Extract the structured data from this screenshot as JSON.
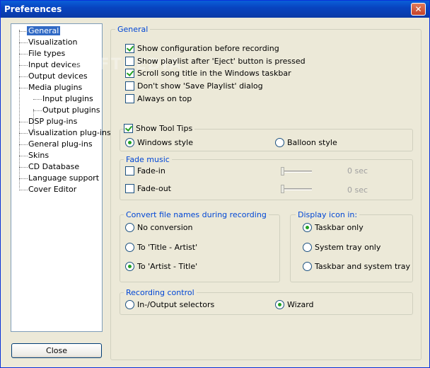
{
  "window": {
    "title": "Preferences",
    "close_glyph": "✕"
  },
  "tree": [
    {
      "label": "General",
      "level": 0,
      "selected": true
    },
    {
      "label": "Visualization",
      "level": 0
    },
    {
      "label": "File types",
      "level": 0
    },
    {
      "label": "Input devices",
      "level": 0
    },
    {
      "label": "Output devices",
      "level": 0
    },
    {
      "label": "Media plugins",
      "level": 0
    },
    {
      "label": "Input plugins",
      "level": 1
    },
    {
      "label": "Output plugins",
      "level": 1
    },
    {
      "label": "DSP plug-ins",
      "level": 0
    },
    {
      "label": "Visualization plug-ins",
      "level": 0
    },
    {
      "label": "General plug-ins",
      "level": 0
    },
    {
      "label": "Skins",
      "level": 0
    },
    {
      "label": "CD Database",
      "level": 0
    },
    {
      "label": "Language support",
      "level": 0
    },
    {
      "label": "Cover Editor",
      "level": 0
    }
  ],
  "close_button": "Close",
  "general": {
    "legend": "General",
    "options": [
      {
        "label": "Show configuration before recording",
        "checked": true
      },
      {
        "label": "Show playlist after 'Eject' button is pressed",
        "checked": false
      },
      {
        "label": "Scroll song title in the Windows taskbar",
        "checked": true
      },
      {
        "label": "Don't show 'Save Playlist' dialog",
        "checked": false
      },
      {
        "label": "Always on top",
        "checked": false
      }
    ]
  },
  "tooltips": {
    "label": "Show Tool Tips",
    "checked": true,
    "windows_style": "Windows style",
    "balloon_style": "Balloon style",
    "selected": "windows"
  },
  "fade": {
    "legend": "Fade music",
    "fade_in": {
      "label": "Fade-in",
      "checked": false,
      "value": "0 sec"
    },
    "fade_out": {
      "label": "Fade-out",
      "checked": false,
      "value": "0 sec"
    }
  },
  "convert": {
    "legend": "Convert file names during recording",
    "options": [
      {
        "label": "No conversion",
        "checked": false
      },
      {
        "label": "To 'Title - Artist'",
        "checked": false
      },
      {
        "label": "To 'Artist - Title'",
        "checked": true
      }
    ]
  },
  "display_icon": {
    "legend": "Display icon in:",
    "options": [
      {
        "label": "Taskbar only",
        "checked": true
      },
      {
        "label": "System tray only",
        "checked": false
      },
      {
        "label": "Taskbar and system tray",
        "checked": false
      }
    ]
  },
  "recording": {
    "legend": "Recording control",
    "selectors": {
      "label": "In-/Output selectors",
      "checked": false
    },
    "wizard": {
      "label": "Wizard",
      "checked": true
    }
  },
  "watermark": "SOFTPEDIA"
}
